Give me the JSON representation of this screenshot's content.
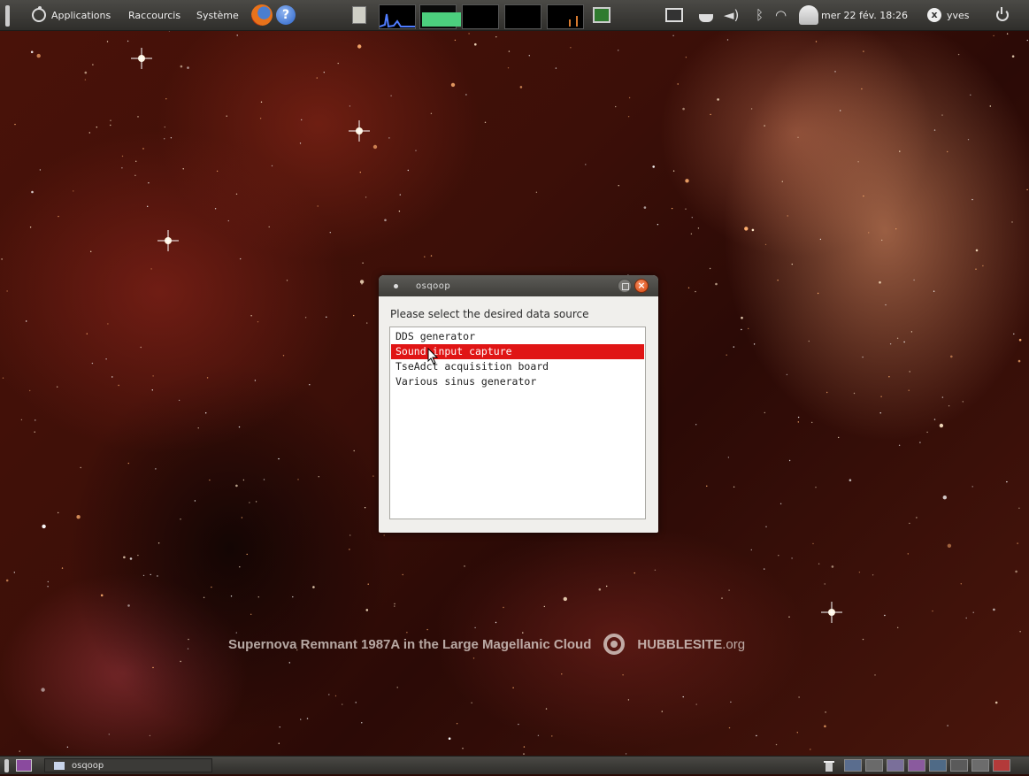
{
  "top_panel": {
    "menus": [
      "Applications",
      "Raccourcis",
      "Système"
    ],
    "icons": [
      "ubuntu-logo-icon",
      "firefox-icon",
      "help-icon",
      "network-monitor-icon",
      "system-monitor-graph",
      "battery-icon",
      "display-icon",
      "tea-timer-icon",
      "volume-icon",
      "bluetooth-icon",
      "wifi-icon",
      "mail-icon",
      "user-icon",
      "power-icon"
    ],
    "help_glyph": "?",
    "clock": "mer 22 fév. 18:26",
    "user_glyph": "x",
    "username": "yves"
  },
  "wallpaper": {
    "caption": "Supernova Remnant 1987A in the Large Magellanic Cloud",
    "brand": "HUBBLESITE",
    "brand_suffix": ".org"
  },
  "dialog": {
    "title": "osqoop",
    "close_glyph": "×",
    "prompt": "Please select the desired data source",
    "items": [
      {
        "label": "DDS generator",
        "selected": false
      },
      {
        "label": "Sound input capture",
        "selected": true
      },
      {
        "label": "TseAdct acquisition board",
        "selected": false
      },
      {
        "label": "Various sinus generator",
        "selected": false
      }
    ],
    "colors": {
      "selection": "#e01515",
      "close_button": "#d9480f"
    }
  },
  "bottom_panel": {
    "task": "osqoop"
  }
}
